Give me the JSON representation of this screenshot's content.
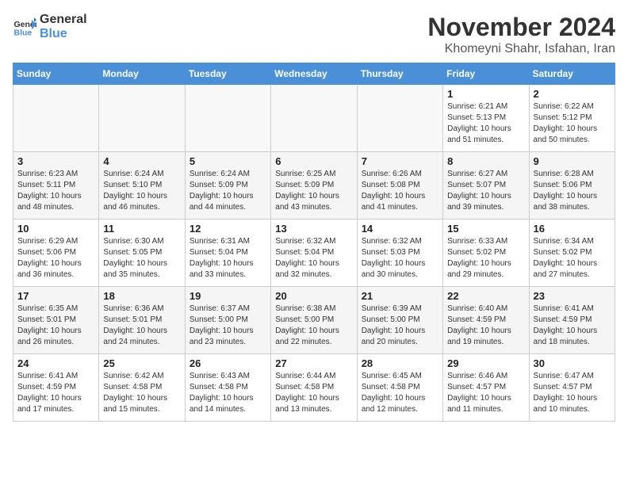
{
  "header": {
    "logo_general": "General",
    "logo_blue": "Blue",
    "month_year": "November 2024",
    "location": "Khomeyni Shahr, Isfahan, Iran"
  },
  "days_of_week": [
    "Sunday",
    "Monday",
    "Tuesday",
    "Wednesday",
    "Thursday",
    "Friday",
    "Saturday"
  ],
  "weeks": [
    [
      {
        "day": "",
        "empty": true
      },
      {
        "day": "",
        "empty": true
      },
      {
        "day": "",
        "empty": true
      },
      {
        "day": "",
        "empty": true
      },
      {
        "day": "",
        "empty": true
      },
      {
        "day": "1",
        "sunrise": "6:21 AM",
        "sunset": "5:13 PM",
        "daylight": "10 hours and 51 minutes."
      },
      {
        "day": "2",
        "sunrise": "6:22 AM",
        "sunset": "5:12 PM",
        "daylight": "10 hours and 50 minutes."
      }
    ],
    [
      {
        "day": "3",
        "sunrise": "6:23 AM",
        "sunset": "5:11 PM",
        "daylight": "10 hours and 48 minutes."
      },
      {
        "day": "4",
        "sunrise": "6:24 AM",
        "sunset": "5:10 PM",
        "daylight": "10 hours and 46 minutes."
      },
      {
        "day": "5",
        "sunrise": "6:24 AM",
        "sunset": "5:09 PM",
        "daylight": "10 hours and 44 minutes."
      },
      {
        "day": "6",
        "sunrise": "6:25 AM",
        "sunset": "5:09 PM",
        "daylight": "10 hours and 43 minutes."
      },
      {
        "day": "7",
        "sunrise": "6:26 AM",
        "sunset": "5:08 PM",
        "daylight": "10 hours and 41 minutes."
      },
      {
        "day": "8",
        "sunrise": "6:27 AM",
        "sunset": "5:07 PM",
        "daylight": "10 hours and 39 minutes."
      },
      {
        "day": "9",
        "sunrise": "6:28 AM",
        "sunset": "5:06 PM",
        "daylight": "10 hours and 38 minutes."
      }
    ],
    [
      {
        "day": "10",
        "sunrise": "6:29 AM",
        "sunset": "5:06 PM",
        "daylight": "10 hours and 36 minutes."
      },
      {
        "day": "11",
        "sunrise": "6:30 AM",
        "sunset": "5:05 PM",
        "daylight": "10 hours and 35 minutes."
      },
      {
        "day": "12",
        "sunrise": "6:31 AM",
        "sunset": "5:04 PM",
        "daylight": "10 hours and 33 minutes."
      },
      {
        "day": "13",
        "sunrise": "6:32 AM",
        "sunset": "5:04 PM",
        "daylight": "10 hours and 32 minutes."
      },
      {
        "day": "14",
        "sunrise": "6:32 AM",
        "sunset": "5:03 PM",
        "daylight": "10 hours and 30 minutes."
      },
      {
        "day": "15",
        "sunrise": "6:33 AM",
        "sunset": "5:02 PM",
        "daylight": "10 hours and 29 minutes."
      },
      {
        "day": "16",
        "sunrise": "6:34 AM",
        "sunset": "5:02 PM",
        "daylight": "10 hours and 27 minutes."
      }
    ],
    [
      {
        "day": "17",
        "sunrise": "6:35 AM",
        "sunset": "5:01 PM",
        "daylight": "10 hours and 26 minutes."
      },
      {
        "day": "18",
        "sunrise": "6:36 AM",
        "sunset": "5:01 PM",
        "daylight": "10 hours and 24 minutes."
      },
      {
        "day": "19",
        "sunrise": "6:37 AM",
        "sunset": "5:00 PM",
        "daylight": "10 hours and 23 minutes."
      },
      {
        "day": "20",
        "sunrise": "6:38 AM",
        "sunset": "5:00 PM",
        "daylight": "10 hours and 22 minutes."
      },
      {
        "day": "21",
        "sunrise": "6:39 AM",
        "sunset": "5:00 PM",
        "daylight": "10 hours and 20 minutes."
      },
      {
        "day": "22",
        "sunrise": "6:40 AM",
        "sunset": "4:59 PM",
        "daylight": "10 hours and 19 minutes."
      },
      {
        "day": "23",
        "sunrise": "6:41 AM",
        "sunset": "4:59 PM",
        "daylight": "10 hours and 18 minutes."
      }
    ],
    [
      {
        "day": "24",
        "sunrise": "6:41 AM",
        "sunset": "4:59 PM",
        "daylight": "10 hours and 17 minutes."
      },
      {
        "day": "25",
        "sunrise": "6:42 AM",
        "sunset": "4:58 PM",
        "daylight": "10 hours and 15 minutes."
      },
      {
        "day": "26",
        "sunrise": "6:43 AM",
        "sunset": "4:58 PM",
        "daylight": "10 hours and 14 minutes."
      },
      {
        "day": "27",
        "sunrise": "6:44 AM",
        "sunset": "4:58 PM",
        "daylight": "10 hours and 13 minutes."
      },
      {
        "day": "28",
        "sunrise": "6:45 AM",
        "sunset": "4:58 PM",
        "daylight": "10 hours and 12 minutes."
      },
      {
        "day": "29",
        "sunrise": "6:46 AM",
        "sunset": "4:57 PM",
        "daylight": "10 hours and 11 minutes."
      },
      {
        "day": "30",
        "sunrise": "6:47 AM",
        "sunset": "4:57 PM",
        "daylight": "10 hours and 10 minutes."
      }
    ]
  ]
}
